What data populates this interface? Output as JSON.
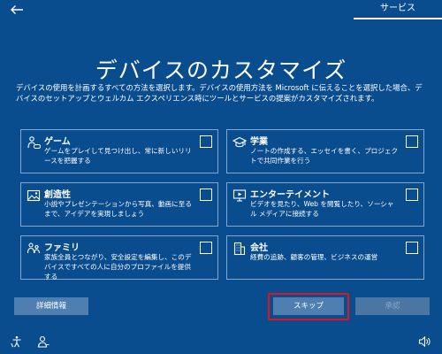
{
  "topbar": {
    "tab_label": "サービス"
  },
  "page": {
    "title": "デバイスのカスタマイズ",
    "description": "デバイスの使用を計画するすべての方法を選択します。デバイスの使用方法を Microsoft に伝えることを選択した場合、デバイスのセットアップとウェルカム エクスペリエンス時にツールとサービスの提案がカスタマイズされます。"
  },
  "cards": [
    {
      "icon": "game-controller-icon",
      "title": "ゲーム",
      "desc": "ゲームをプレイして見つけ出し、常に新しいリリースを把握する",
      "checked": false
    },
    {
      "icon": "graduation-cap-icon",
      "title": "学業",
      "desc": "ノートの作成する、エッセイを書く、プロジェクトで共同作業を行う",
      "checked": false
    },
    {
      "icon": "image-icon",
      "title": "創造性",
      "desc": "小説やプレゼンテーションから写真、動画に至るまで、アイデアを実現しましょう",
      "checked": false
    },
    {
      "icon": "entertainment-icon",
      "title": "エンターテイメント",
      "desc": "ビデオを見たり、Web を閲覧したり、ソーシャル メディアに接続する",
      "checked": false
    },
    {
      "icon": "family-icon",
      "title": "ファミリ",
      "desc": "家族全員とつながり、安全設定を編集し、このデバイスですべての人に自分のプロファイルを提供する",
      "checked": false
    },
    {
      "icon": "business-icon",
      "title": "会社",
      "desc": "経費の追跡、顧客の管理、ビジネスの運営",
      "checked": false
    }
  ],
  "buttons": {
    "details": "詳細情報",
    "skip": "スキップ",
    "accept": "承認"
  }
}
